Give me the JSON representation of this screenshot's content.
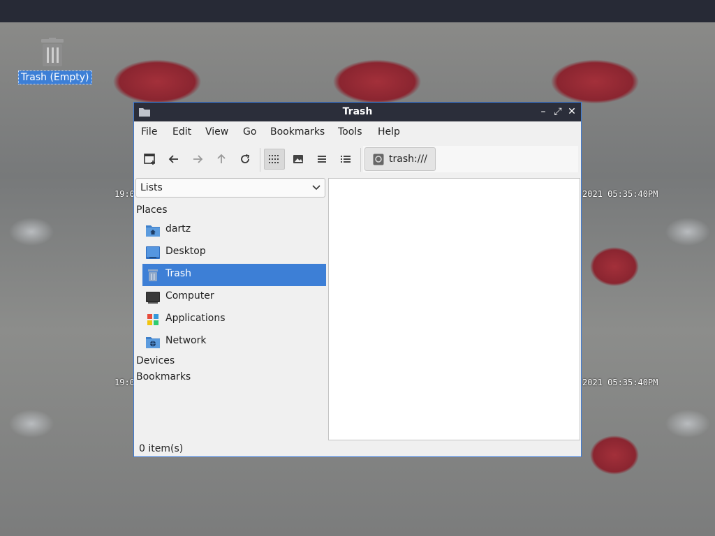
{
  "desktop": {
    "trash_label": "Trash (Empty)",
    "overlay_timestamps": [
      "19:0",
      "2021 05:35:40PM",
      "19:0",
      "2021 05:35:40PM"
    ]
  },
  "window": {
    "title": "Trash",
    "controls": {
      "minimize": "–",
      "maximize": "⤢",
      "close": "✕"
    }
  },
  "menu": {
    "items": [
      "File",
      "Edit",
      "View",
      "Go",
      "Bookmarks",
      "Tools",
      "Help"
    ]
  },
  "toolbar": {
    "path": "trash:///"
  },
  "sidebar": {
    "mode": "Lists",
    "places_heading": "Places",
    "places": [
      {
        "label": "dartz",
        "icon": "home-folder-icon"
      },
      {
        "label": "Desktop",
        "icon": "desktop-icon"
      },
      {
        "label": "Trash",
        "icon": "trash-icon"
      },
      {
        "label": "Computer",
        "icon": "computer-icon"
      },
      {
        "label": "Applications",
        "icon": "applications-icon"
      },
      {
        "label": "Network",
        "icon": "network-icon"
      }
    ],
    "devices_heading": "Devices",
    "bookmarks_heading": "Bookmarks"
  },
  "status": {
    "items_text": "0 item(s)"
  },
  "colors": {
    "accent": "#3d7fd6",
    "titlebar": "#2b2e3a",
    "topbar": "#272a36"
  }
}
